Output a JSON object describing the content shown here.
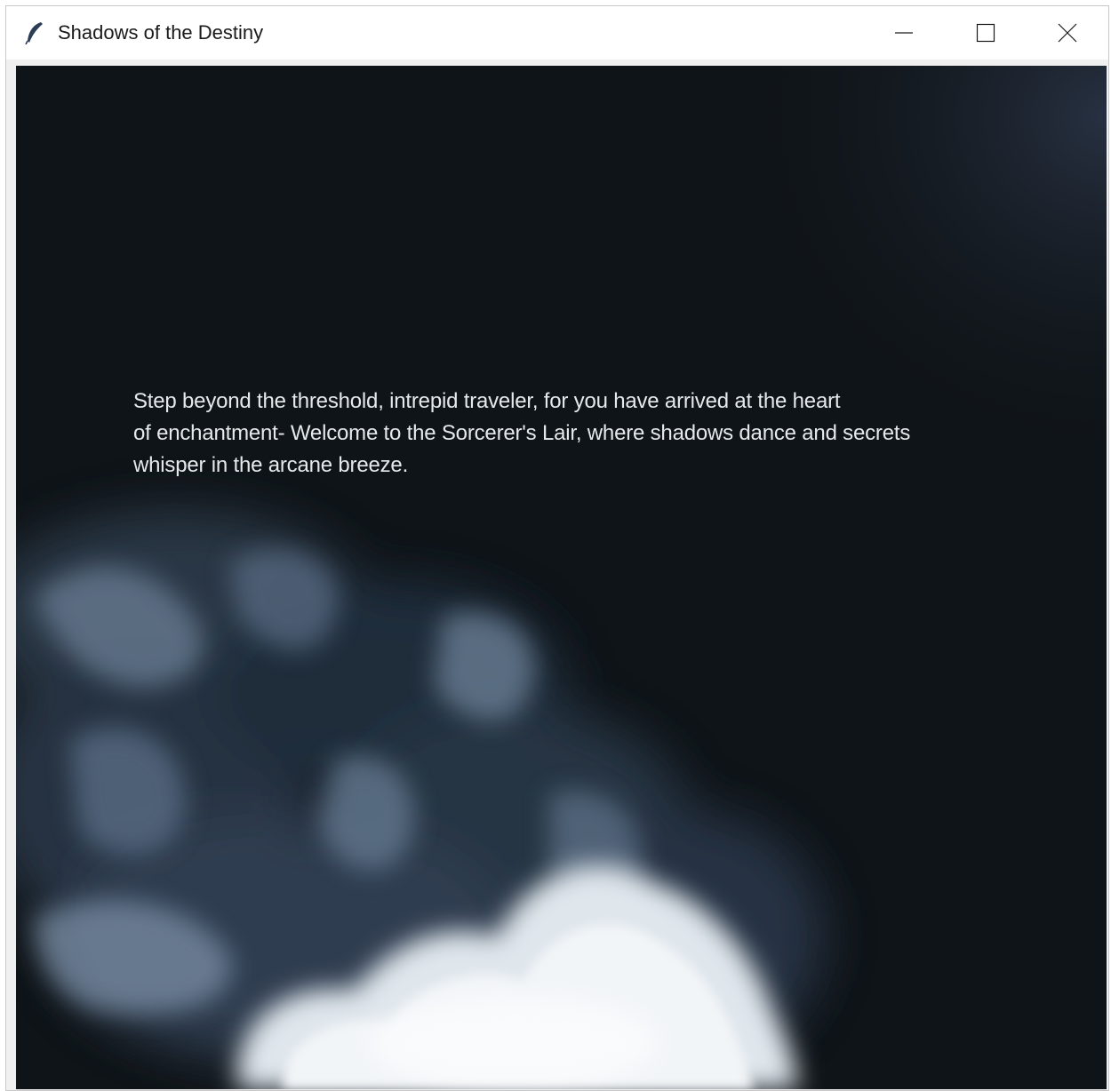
{
  "window": {
    "title": "Shadows of the Destiny",
    "app_icon": "feather-icon",
    "controls": {
      "minimize_icon": "minimize-icon",
      "maximize_icon": "maximize-icon",
      "close_icon": "close-icon"
    }
  },
  "scene": {
    "background": "dark-smoke-illustration",
    "intro_lines": [
      "Step beyond the threshold, intrepid traveler, for you have arrived at the heart",
      "of enchantment- Welcome to the Sorcerer's Lair, where shadows dance and secrets",
      "whisper in the arcane breeze."
    ]
  },
  "colors": {
    "background_dark": "#0f1418",
    "smoke_light": "#eef2f6",
    "smoke_mid": "#5b6f86",
    "text": "#e6e9ec"
  }
}
